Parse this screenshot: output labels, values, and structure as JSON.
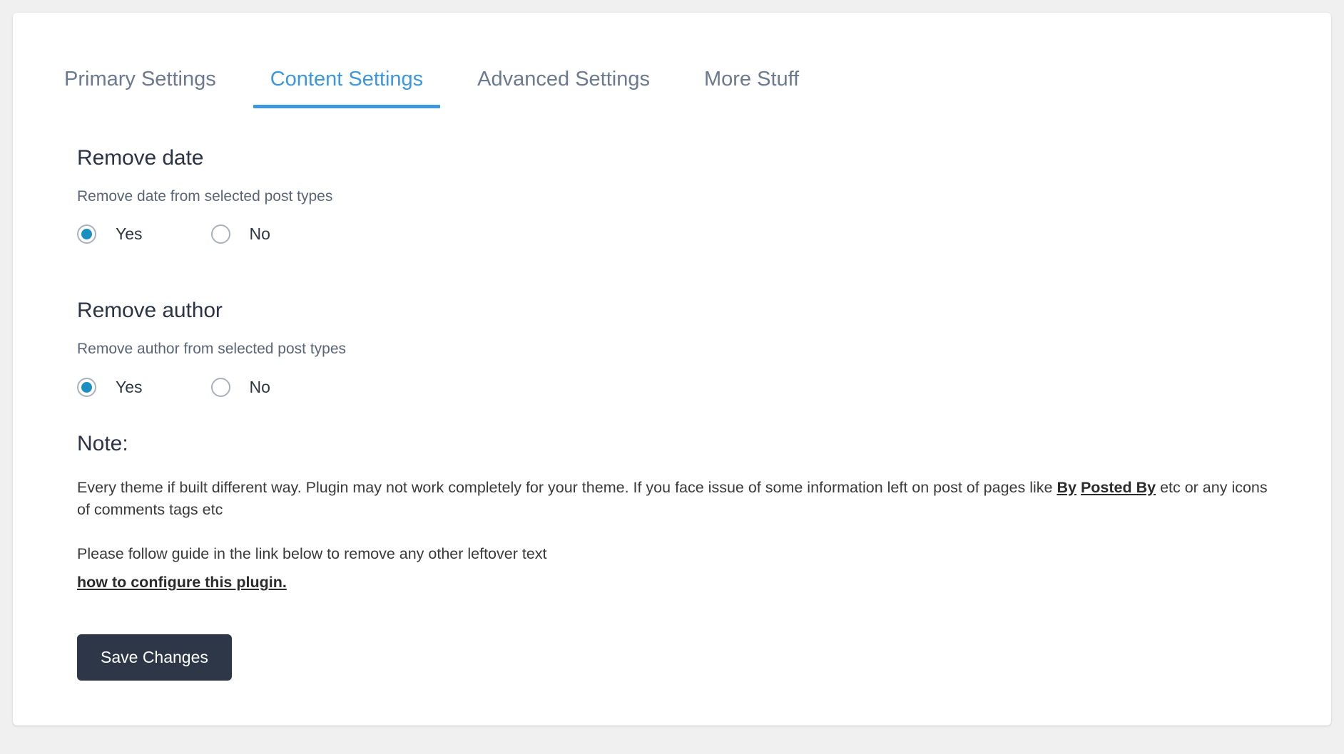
{
  "theme": {
    "page_background": "#f0f0f0",
    "card_background": "#ffffff",
    "accent_blue": "#3c97dd",
    "radio_fill": "#1a8fc1",
    "button_background": "#2d3748",
    "heading_color": "#2b3445",
    "muted_text": "#5a6678"
  },
  "tabs": [
    {
      "label": "Primary Settings",
      "active": false
    },
    {
      "label": "Content Settings",
      "active": true
    },
    {
      "label": "Advanced Settings",
      "active": false
    },
    {
      "label": "More Stuff",
      "active": false
    }
  ],
  "sections": [
    {
      "title": "Remove date",
      "description": "Remove date from selected post types",
      "options": [
        {
          "label": "Yes",
          "selected": true
        },
        {
          "label": "No",
          "selected": false
        }
      ]
    },
    {
      "title": "Remove author",
      "description": "Remove author from selected post types",
      "options": [
        {
          "label": "Yes",
          "selected": true
        },
        {
          "label": "No",
          "selected": false
        }
      ]
    }
  ],
  "note": {
    "title": "Note:",
    "paragraph_1_part_1": "Every theme if built different way. Plugin may not work completely for your theme. If you face issue of some information left on post of pages like ",
    "paragraph_1_bold_1": "By",
    "paragraph_1_part_2": " ",
    "paragraph_1_bold_2": "Posted By",
    "paragraph_1_part_3": " etc or any icons of comments tags etc",
    "paragraph_2": "Please follow guide in the link below to remove any other leftover text",
    "link_label": "how to configure this plugin."
  },
  "actions": {
    "save_label": "Save Changes"
  }
}
